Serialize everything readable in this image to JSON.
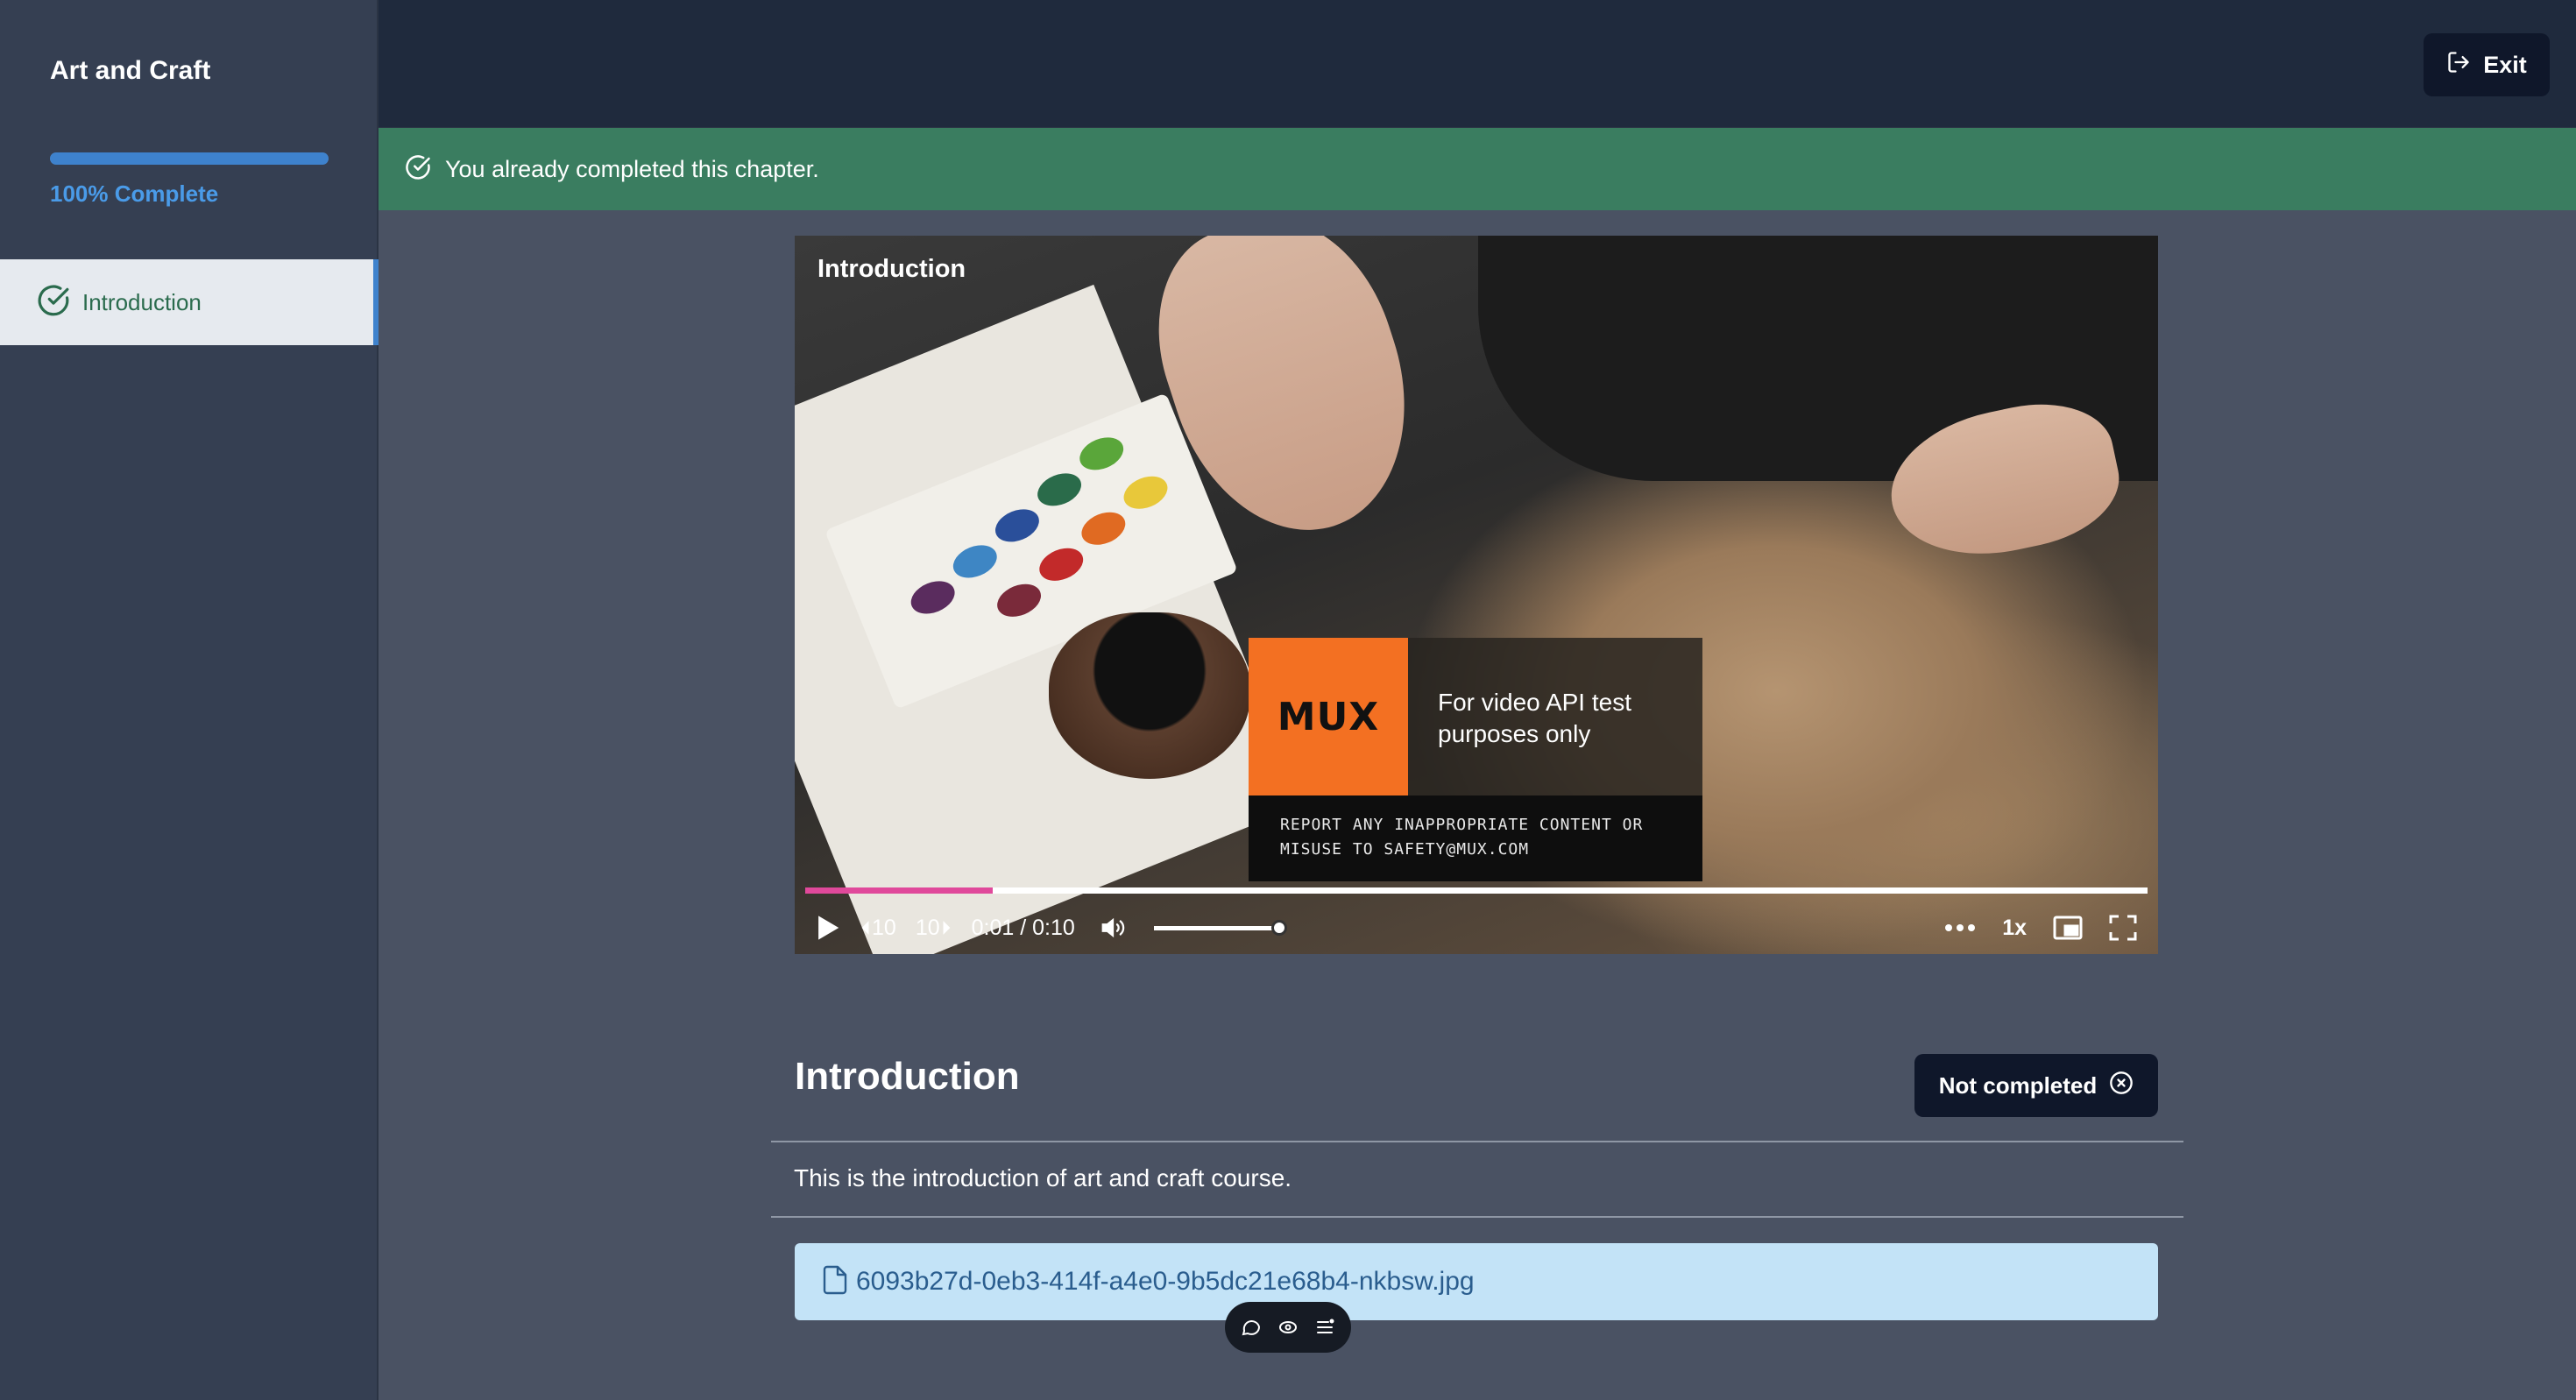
{
  "sidebar": {
    "course_title": "Art and Craft",
    "progress_percent": 100,
    "progress_label": "100% Complete",
    "chapters": [
      {
        "label": "Introduction",
        "completed": true,
        "active": true
      }
    ]
  },
  "header": {
    "exit_label": "Exit"
  },
  "banner": {
    "text": "You already completed this chapter.",
    "color": "#3a7d60"
  },
  "video": {
    "title": "Introduction",
    "watermark": {
      "logo": "MUX",
      "line1": "For video API test",
      "line2": "purposes only",
      "report1": "REPORT ANY INAPPROPRIATE CONTENT OR",
      "report2": "MISUSE TO SAFETY@MUX.COM"
    },
    "progress_fraction": 0.14,
    "time": "0:01 / 0:10",
    "seek_back": "10",
    "seek_forward": "10",
    "volume_fraction": 1.0,
    "playback_rate": "1x"
  },
  "chapter": {
    "title": "Introduction",
    "status_label": "Not completed",
    "description": "This is the introduction of art and craft course.",
    "attachment_name": "6093b27d-0eb3-414f-a4e0-9b5dc21e68b4-nkbsw.jpg"
  },
  "colors": {
    "accent": "#3e82cd",
    "dark_button": "#0f172a",
    "attachment_bg": "#c3e3f7",
    "scrubber_played": "#e0499b"
  }
}
